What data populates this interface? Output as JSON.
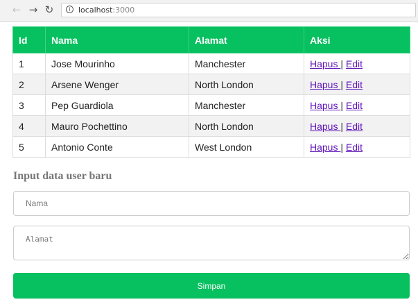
{
  "browser": {
    "url_host": "localhost",
    "url_port": ":3000",
    "back_icon": "arrow-left-icon",
    "forward_icon": "arrow-right-icon",
    "reload_icon": "reload-icon",
    "info_icon": "info-icon"
  },
  "table": {
    "headers": [
      "Id",
      "Nama",
      "Alamat",
      "Aksi"
    ],
    "rows": [
      {
        "id": "1",
        "nama": "Jose Mourinho",
        "alamat": "Manchester",
        "hapus": "Hapus ",
        "sep": "|",
        "edit": "Edit"
      },
      {
        "id": "2",
        "nama": "Arsene Wenger",
        "alamat": "North London",
        "hapus": "Hapus ",
        "sep": "|",
        "edit": "Edit"
      },
      {
        "id": "3",
        "nama": "Pep Guardiola",
        "alamat": "Manchester",
        "hapus": "Hapus ",
        "sep": "|",
        "edit": "Edit"
      },
      {
        "id": "4",
        "nama": "Mauro Pochettino",
        "alamat": "North London",
        "hapus": "Hapus ",
        "sep": "|",
        "edit": "Edit"
      },
      {
        "id": "5",
        "nama": "Antonio Conte",
        "alamat": "West London",
        "hapus": "Hapus ",
        "sep": "|",
        "edit": "Edit"
      }
    ]
  },
  "form": {
    "title": "Input data user baru",
    "nama_placeholder": "Nama",
    "nama_value": "",
    "alamat_placeholder": "Alamat",
    "alamat_value": "",
    "submit_label": "Simpan"
  },
  "colors": {
    "accent": "#07c05f",
    "link": "#5d12b9",
    "row_alt": "#f2f2f2"
  }
}
